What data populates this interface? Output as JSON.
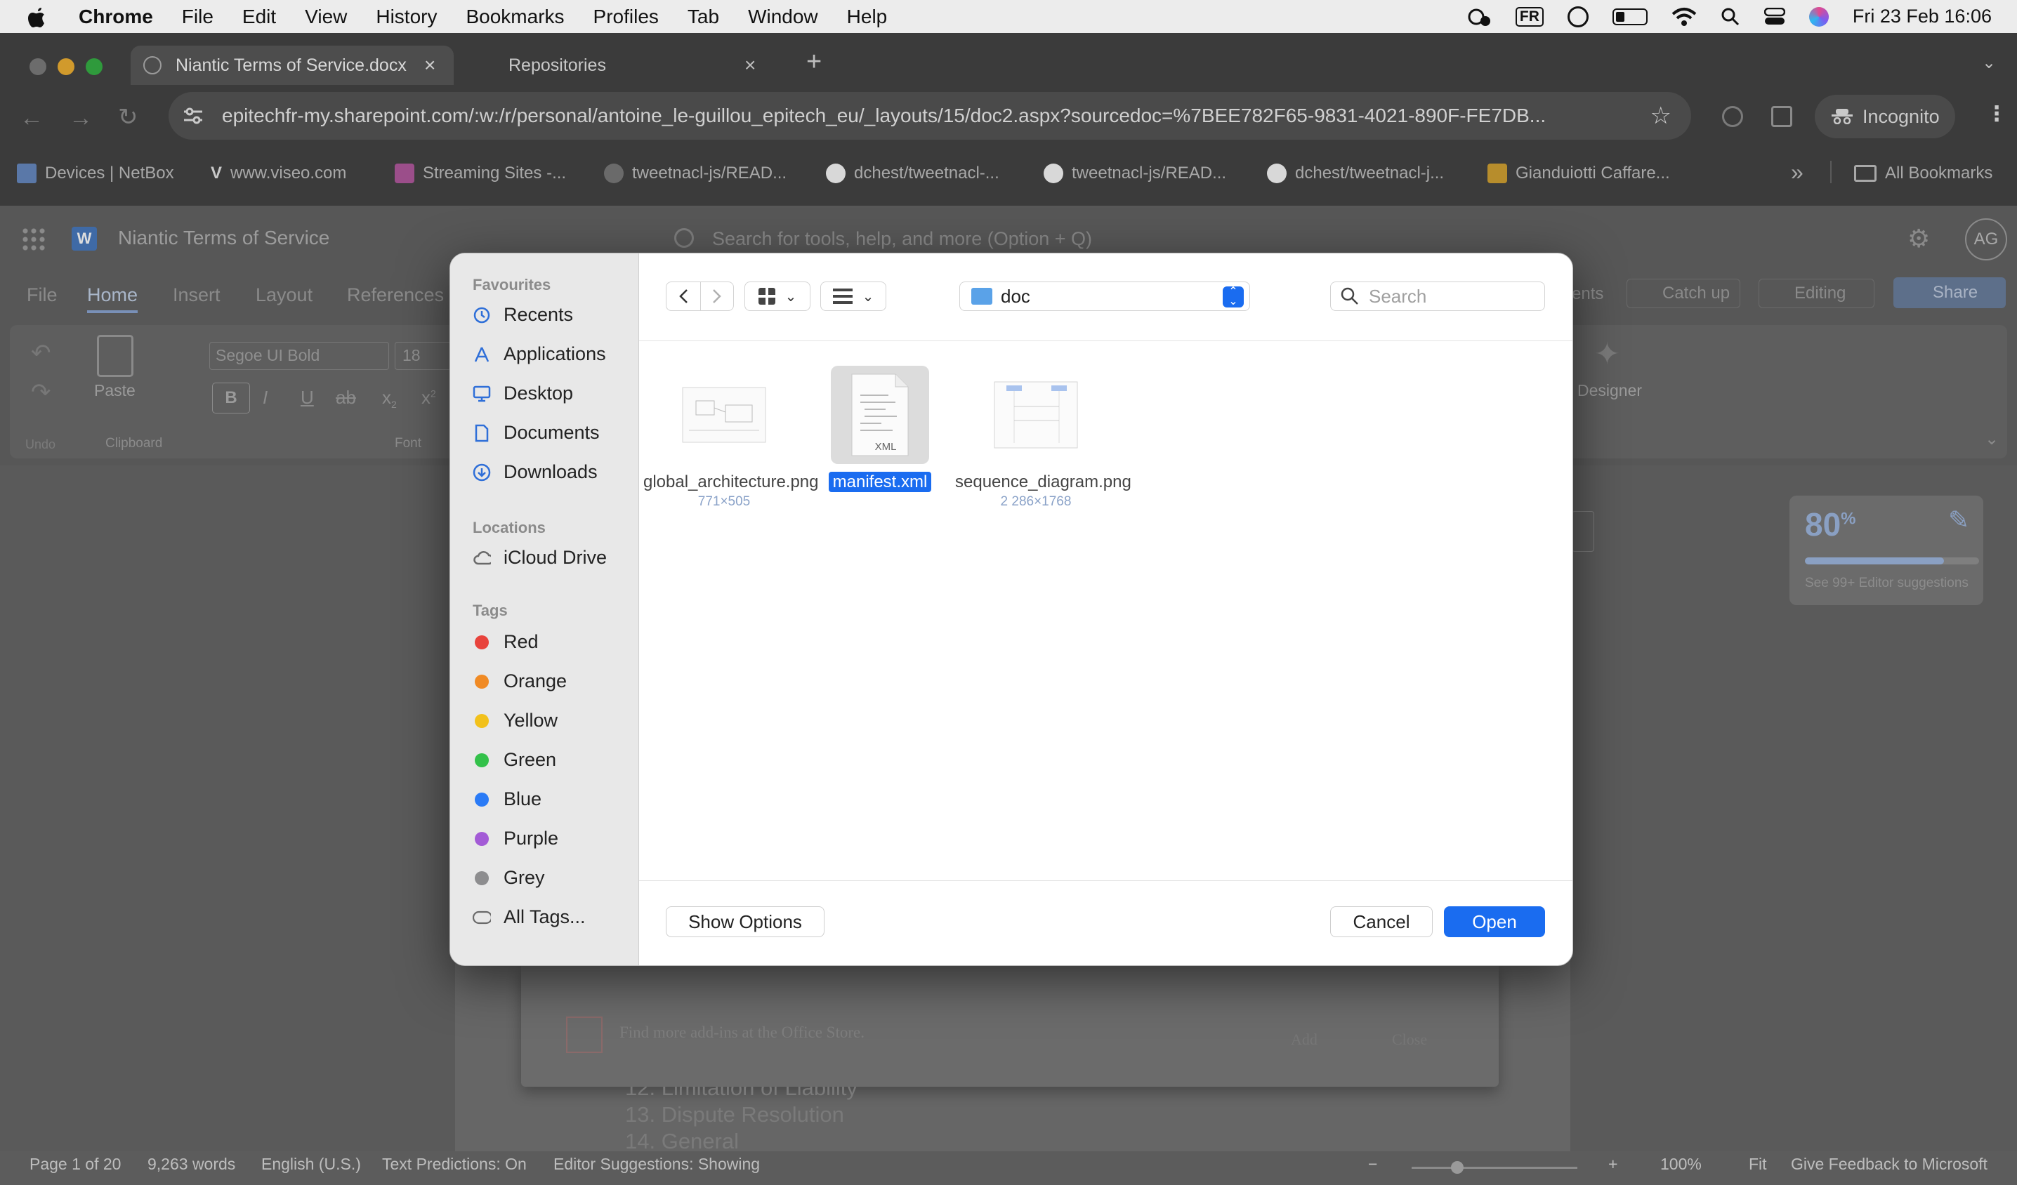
{
  "menubar": {
    "app": "Chrome",
    "items": [
      "File",
      "Edit",
      "View",
      "History",
      "Bookmarks",
      "Profiles",
      "Tab",
      "Window",
      "Help"
    ],
    "input_source": "FR",
    "datetime": "Fri 23 Feb  16:06"
  },
  "browser": {
    "tabs": [
      {
        "title": "Niantic Terms of Service.docx"
      },
      {
        "title": "Repositories"
      }
    ],
    "url": "epitechfr-my.sharepoint.com/:w:/r/personal/antoine_le-guillou_epitech_eu/_layouts/15/doc2.aspx?sourcedoc=%7BEE782F65-9831-4021-890F-FE7DB...",
    "profile": "Incognito",
    "bookmarks": [
      "Devices | NetBox",
      "www.viseo.com",
      "Streaming Sites -...",
      "tweetnacl-js/READ...",
      "dchest/tweetnacl-...",
      "tweetnacl-js/READ...",
      "dchest/tweetnacl-j...",
      "Gianduiotti Caffare..."
    ],
    "all_bookmarks": "All Bookmarks"
  },
  "word": {
    "doc_title": "Niantic Terms of Service",
    "search_placeholder": "Search for tools, help, and more (Option + Q)",
    "avatar": "AG",
    "tabs": [
      "File",
      "Home",
      "Insert",
      "Layout",
      "References"
    ],
    "right_tabs": [
      "ents",
      "Catch up",
      "Editing",
      "Share"
    ],
    "font_name": "Segoe UI Bold",
    "font_size": "18",
    "groups": {
      "undo": "Undo",
      "clipboard": "Clipboard",
      "paste": "Paste",
      "font": "Font",
      "designer": "Designer"
    },
    "editor_score": "80",
    "editor_score_unit": "%",
    "editor_suggestions": "See 99+ Editor suggestions",
    "editor_progress": 0.8,
    "addin_text": "Find more add-ins at the Office Store.",
    "addin_add": "Add",
    "addin_close": "Close",
    "doc_lines": [
      "12. Limitation of Liability",
      "13. Dispute Resolution",
      "14. General"
    ],
    "status": {
      "page": "Page 1 of 20",
      "words": "9,263 words",
      "language": "English (U.S.)",
      "predictions": "Text Predictions: On",
      "suggestions": "Editor Suggestions: Showing",
      "zoom": "100%",
      "fit": "Fit",
      "feedback": "Give Feedback to Microsoft"
    }
  },
  "dialog": {
    "sections": {
      "favourites": "Favourites",
      "locations": "Locations",
      "tags": "Tags"
    },
    "favourites": [
      {
        "label": "Recents",
        "icon": "clock-icon"
      },
      {
        "label": "Applications",
        "icon": "applications-icon"
      },
      {
        "label": "Desktop",
        "icon": "desktop-icon"
      },
      {
        "label": "Documents",
        "icon": "document-icon"
      },
      {
        "label": "Downloads",
        "icon": "download-icon"
      }
    ],
    "locations": [
      {
        "label": "iCloud Drive",
        "icon": "cloud-icon"
      }
    ],
    "tags": [
      {
        "label": "Red",
        "color": "#e8433c"
      },
      {
        "label": "Orange",
        "color": "#f08a24"
      },
      {
        "label": "Yellow",
        "color": "#f2c11b"
      },
      {
        "label": "Green",
        "color": "#33c14a"
      },
      {
        "label": "Blue",
        "color": "#2a7bf6"
      },
      {
        "label": "Purple",
        "color": "#a35bd6"
      },
      {
        "label": "Grey",
        "color": "#8d8d8f"
      }
    ],
    "all_tags": "All Tags...",
    "folder": "doc",
    "search_placeholder": "Search",
    "files": [
      {
        "name": "global_architecture.png",
        "dims": "771×505",
        "selected": false
      },
      {
        "name": "manifest.xml",
        "kind": "XML",
        "selected": true
      },
      {
        "name": "sequence_diagram.png",
        "dims": "2 286×1768",
        "selected": false
      }
    ],
    "buttons": {
      "options": "Show Options",
      "cancel": "Cancel",
      "open": "Open"
    },
    "accent": "#1a6cf0"
  }
}
